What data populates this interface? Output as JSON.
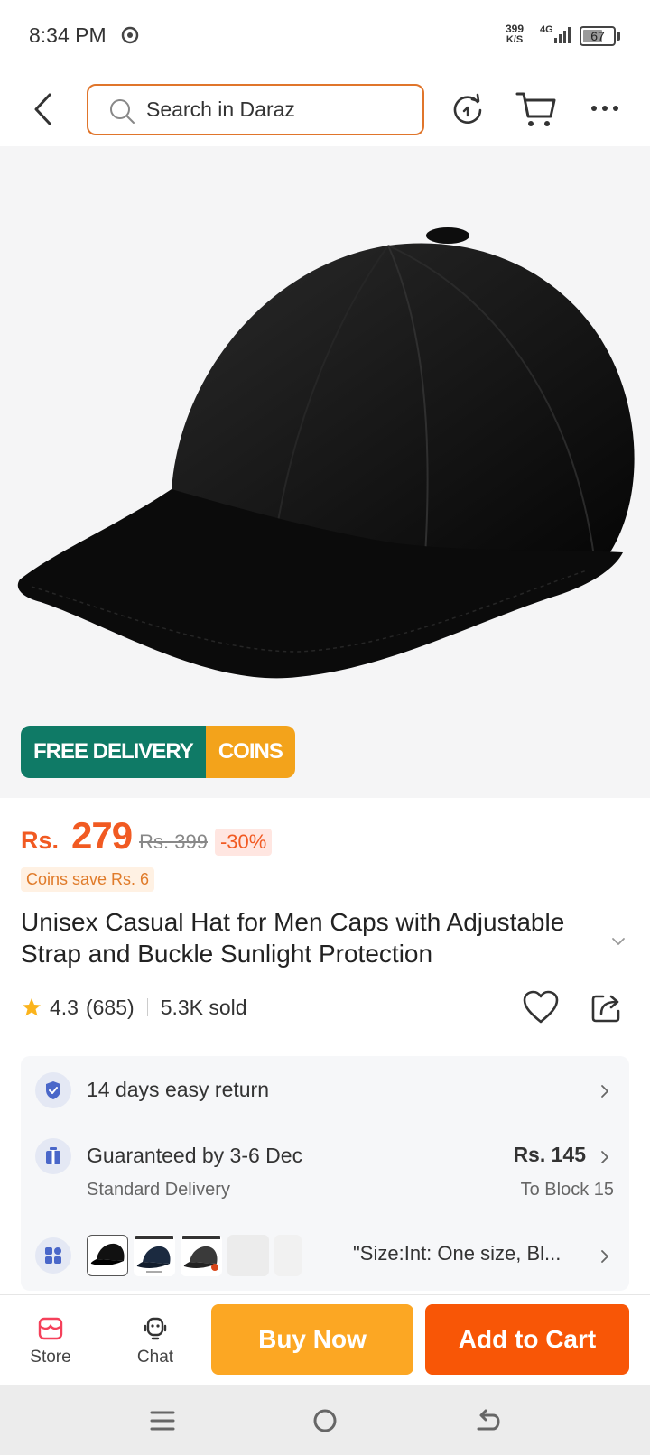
{
  "status_bar": {
    "time": "8:34 PM",
    "net_speed_value": "399",
    "net_speed_unit": "K/S",
    "network": "4G",
    "battery": "67",
    "battery_level": 0.67
  },
  "header": {
    "search_placeholder": "Search in Daraz",
    "icons": [
      "back-icon",
      "search-icon",
      "refresh-icon",
      "cart-icon",
      "more-icon"
    ]
  },
  "badges": {
    "free_delivery": "FREE DELIVERY",
    "coins": "COINS"
  },
  "price": {
    "currency": "Rs.",
    "current": "279",
    "original": "Rs. 399",
    "discount": "-30%",
    "coins_save": "Coins save Rs. 6"
  },
  "product": {
    "title": "Unisex Casual Hat for Men Caps with Adjustable Strap and Buckle Sunlight Protection",
    "rating": "4.3",
    "reviews": "(685)",
    "sold": "5.3K sold"
  },
  "info": {
    "return_text": "14 days easy return",
    "delivery_text": "Guaranteed by 3-6 Dec",
    "delivery_sub": "Standard Delivery",
    "delivery_fee": "Rs. 145",
    "delivery_location": "To Block 15",
    "variant_text": "\"Size:Int: One size, Bl..."
  },
  "bottom_bar": {
    "store_label": "Store",
    "chat_label": "Chat",
    "buy_now_label": "Buy Now",
    "add_to_cart_label": "Add to Cart"
  },
  "colors": {
    "accent_orange": "#f85606",
    "buy_now": "#fca723",
    "free_delivery_green": "#0f7a66",
    "coins_yellow": "#f3a31b",
    "search_border": "#e0752b"
  }
}
